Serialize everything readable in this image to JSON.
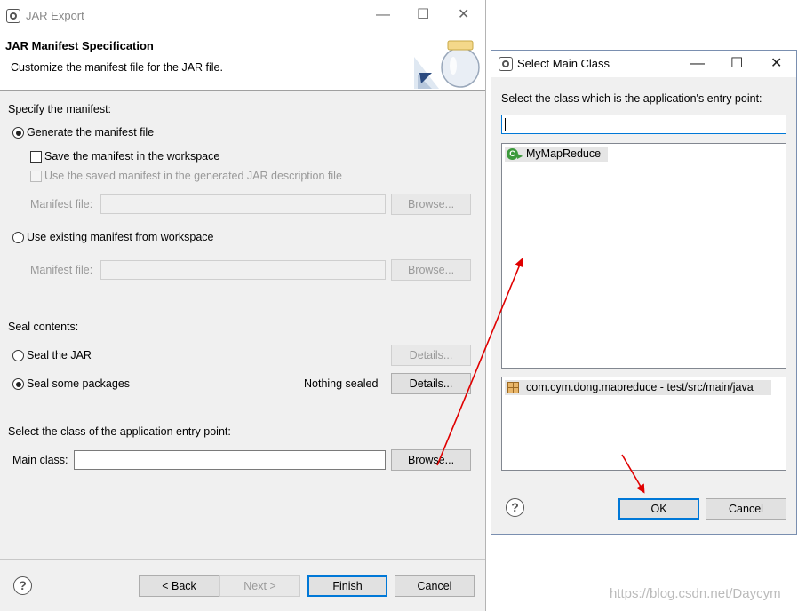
{
  "jar_export": {
    "window_title": "JAR Export",
    "header_title": "JAR Manifest Specification",
    "header_subtitle": "Customize the manifest file for the JAR file.",
    "specify_label": "Specify the manifest:",
    "generate_radio": "Generate the manifest file",
    "save_manifest_check": "Save the manifest in the workspace",
    "use_saved_check": "Use the saved manifest in the generated JAR description file",
    "manifest_file_label": "Manifest file:",
    "manifest_file_label_2": "Manifest file:",
    "browse_1": "Browse...",
    "use_existing_radio": "Use existing manifest from workspace",
    "browse_2": "Browse...",
    "seal_contents_label": "Seal contents:",
    "seal_jar_radio": "Seal the JAR",
    "details_1": "Details...",
    "seal_some_radio": "Seal some packages",
    "nothing_sealed": "Nothing sealed",
    "details_2": "Details...",
    "entry_point_label": "Select the class of the application entry point:",
    "main_class_label": "Main class:",
    "main_class_value": "",
    "browse_3": "Browse...",
    "back_button": "< Back",
    "next_button": "Next >",
    "finish_button": "Finish",
    "cancel_button": "Cancel"
  },
  "select_main_class": {
    "window_title": "Select Main Class",
    "prompt": "Select the class which is the application's entry point:",
    "filter_value": "",
    "classes": [
      "MyMapReduce"
    ],
    "packages": [
      "com.cym.dong.mapreduce - test/src/main/java"
    ],
    "ok_button": "OK",
    "cancel_button": "Cancel"
  },
  "watermark": "https://blog.csdn.net/Daycym",
  "icons": {
    "minimize": "—",
    "maximize": "☐",
    "close": "✕",
    "help": "?"
  },
  "colors": {
    "annotation_arrow": "#e00000",
    "default_button_border": "#0078d7",
    "class_icon": "#3d9a3d"
  }
}
